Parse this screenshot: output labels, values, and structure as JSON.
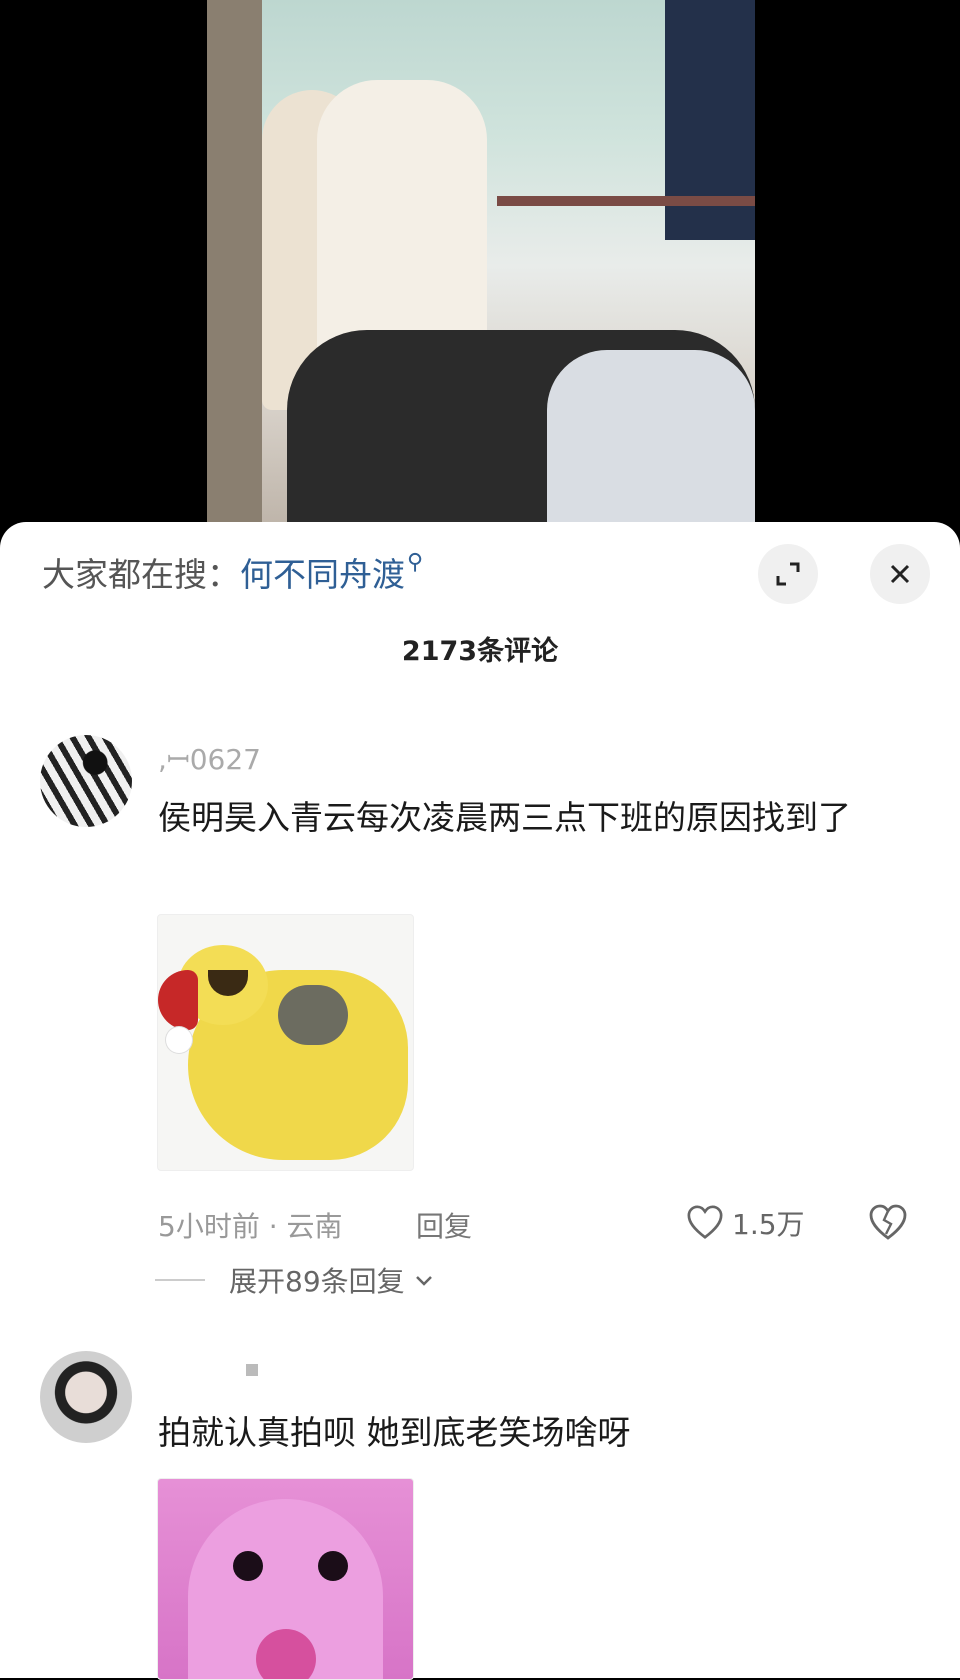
{
  "search": {
    "label": "大家都在搜：",
    "term": "何不同舟渡"
  },
  "comments_count": "2173条评论",
  "comments": [
    {
      "username": "​,ꟷ0627",
      "text": "侯明昊入青云每次凌晨两三点下班的原因找到了",
      "time_location": "5小时前 · 云南",
      "reply_label": "回复",
      "likes": "1.5万",
      "expand_label": "展开89条回复"
    },
    {
      "username": "",
      "text": "拍就认真拍呗 她到底老笑场啥呀"
    }
  ],
  "icons": {
    "expand": "expand-icon",
    "close": "close-icon",
    "search": "search-icon",
    "like": "heart-icon",
    "dislike": "broken-heart-icon",
    "chevron": "chevron-down-icon"
  },
  "colors": {
    "search_term": "#2f5f95",
    "background_top": "#000000",
    "sheet": "#ffffff"
  }
}
